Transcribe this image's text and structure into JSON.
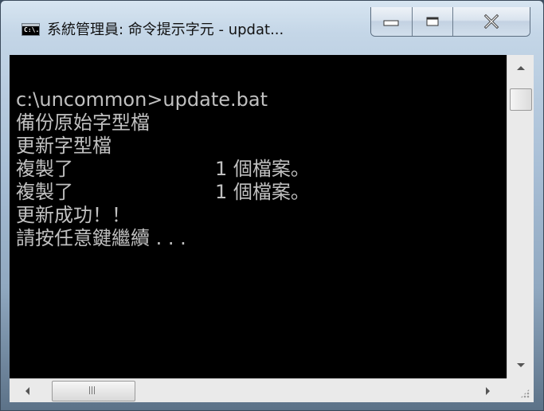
{
  "window": {
    "title": "系統管理員: 命令提示字元 - updat...",
    "icon_label": "C:\\."
  },
  "console": {
    "lines": [
      {
        "text": "c:\\uncommon>update.bat",
        "col2": ""
      },
      {
        "text": "備份原始字型檔",
        "col2": ""
      },
      {
        "text": "更新字型檔",
        "col2": ""
      },
      {
        "text": "複製了",
        "col2": "1 個檔案。"
      },
      {
        "text": "複製了",
        "col2": "1 個檔案。"
      },
      {
        "text": "更新成功！！",
        "col2": ""
      },
      {
        "text": "請按任意鍵繼續 . . .",
        "col2": ""
      }
    ],
    "text_color": "#c0c0c0",
    "background": "#000000"
  },
  "icons": {
    "minimize": "minimize-icon",
    "maximize": "maximize-icon",
    "close": "close-icon",
    "scroll_up": "arrow-up-icon",
    "scroll_down": "arrow-down-icon",
    "scroll_left": "arrow-left-icon",
    "scroll_right": "arrow-right-icon"
  }
}
